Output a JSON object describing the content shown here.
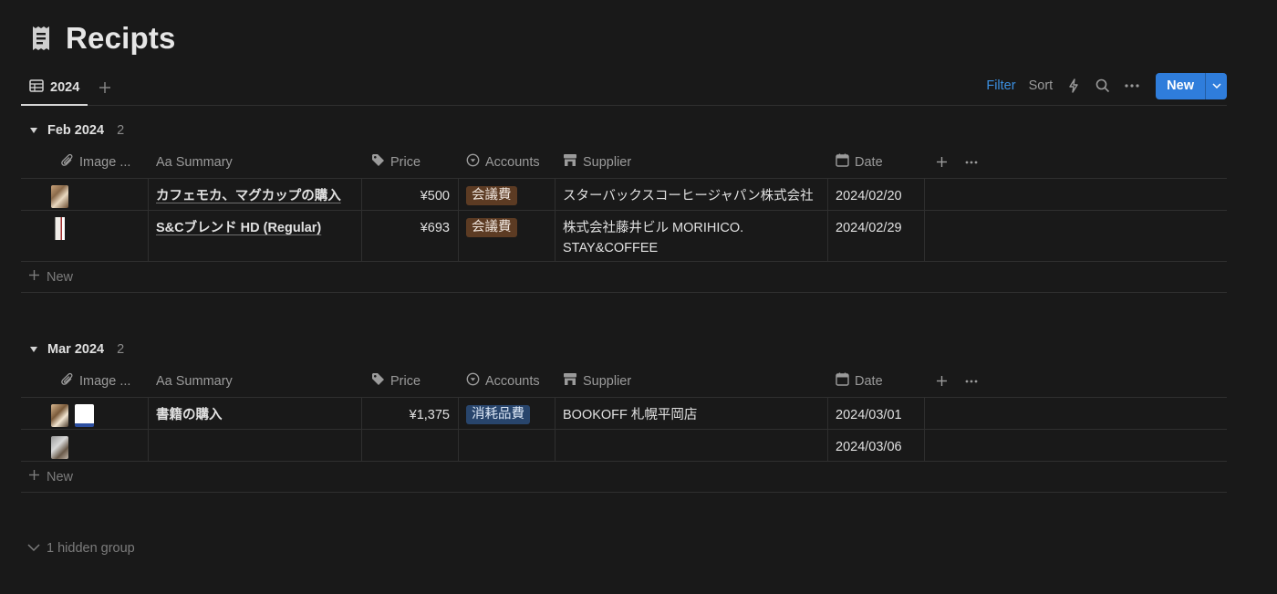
{
  "page": {
    "title": "Recipts",
    "icon": "receipt-icon"
  },
  "view": {
    "tab_label": "2024",
    "tab_icon": "table-icon"
  },
  "toolbar": {
    "filter_label": "Filter",
    "sort_label": "Sort",
    "new_label": "New"
  },
  "columns": {
    "image": "Image ...",
    "summary": "Aa Summary",
    "price": "Price",
    "accounts": "Accounts",
    "supplier": "Supplier",
    "date": "Date"
  },
  "groups": [
    {
      "name": "Feb 2024",
      "count": "2",
      "rows": [
        {
          "summary": "カフェモカ、マグカップの購入",
          "price": "¥500",
          "account": "会議費",
          "supplier": "スターバックスコーヒージャパン株式会社",
          "date": "2024/02/20"
        },
        {
          "summary": "S&Cブレンド HD (Regular)",
          "price": "¥693",
          "account": "会議費",
          "supplier": "株式会社藤井ビル MORIHICO. STAY&COFFEE",
          "date": "2024/02/29"
        }
      ]
    },
    {
      "name": "Mar 2024",
      "count": "2",
      "rows": [
        {
          "summary": "書籍の購入",
          "price": "¥1,375",
          "account": "消耗品費",
          "supplier": "BOOKOFF 札幌平岡店",
          "date": "2024/03/01"
        },
        {
          "summary": "",
          "price": "",
          "account": "",
          "supplier": "",
          "date": "2024/03/06"
        }
      ]
    }
  ],
  "new_row_label": "New",
  "hidden_group_label": "1 hidden group",
  "colors": {
    "background": "#191919",
    "accent": "#2f7ddb",
    "tag_brown": "#5c3b23",
    "tag_blue": "#28456c"
  }
}
